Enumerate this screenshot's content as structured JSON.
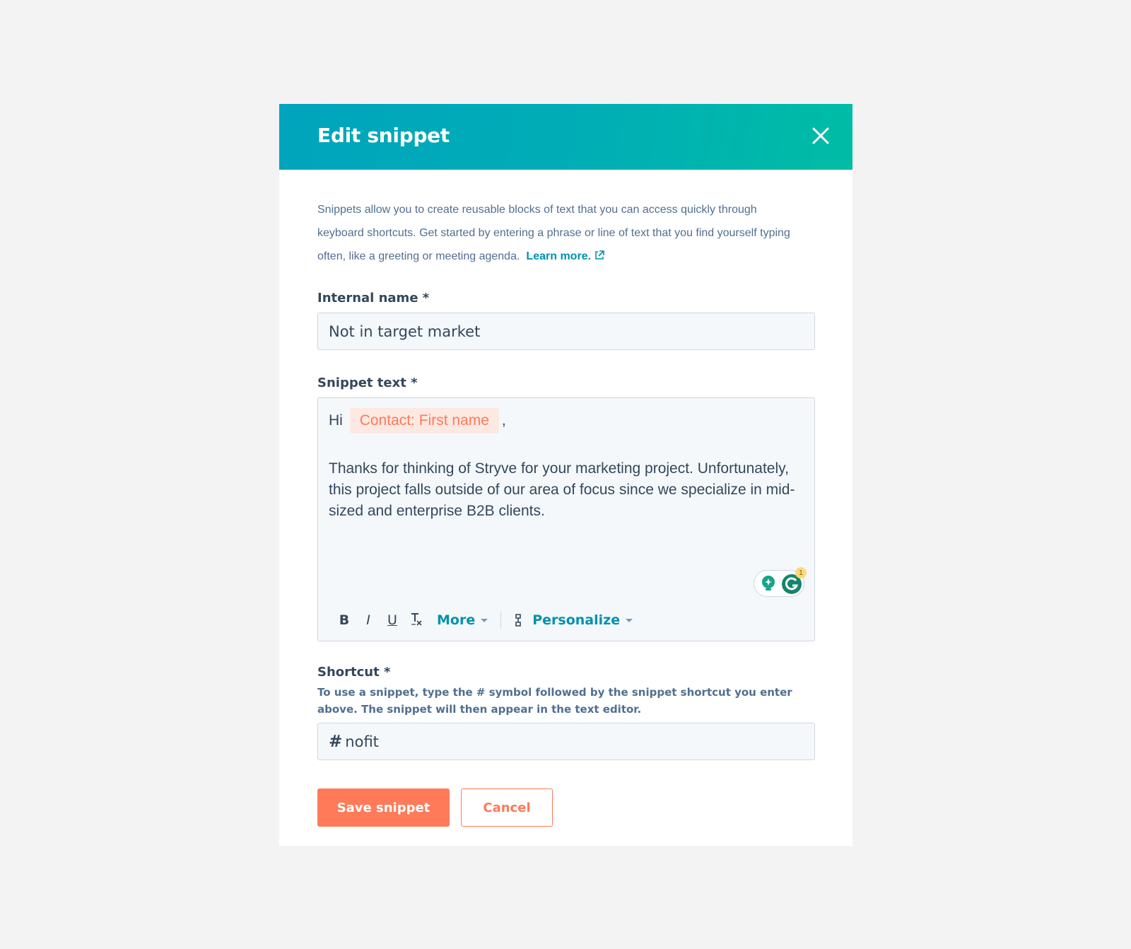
{
  "modal": {
    "title": "Edit snippet",
    "close_icon": "close-icon"
  },
  "intro": {
    "text": "Snippets allow you to create reusable blocks of text that you can access quickly through keyboard shortcuts. Get started by entering a phrase or line of text that you find yourself typing often, like a greeting or meeting agenda.",
    "link_label": "Learn more.",
    "link_icon": "external-link-icon"
  },
  "internal_name": {
    "label": "Internal name *",
    "value": "Not in target market"
  },
  "snippet_text": {
    "label": "Snippet text *",
    "greeting": "Hi",
    "token": "Contact: First name",
    "after_token": ",",
    "paragraph": "Thanks for thinking of Stryve for your marketing project. Unfortunately, this project falls outside of our area of focus since we specialize in mid-sized and enterprise B2B clients."
  },
  "toolbar": {
    "bold": "B",
    "italic": "I",
    "underline": "U",
    "clear_format": "Tx",
    "more_label": "More",
    "personalize_label": "Personalize"
  },
  "grammarly": {
    "badge_count": "1"
  },
  "shortcut": {
    "label": "Shortcut *",
    "help": "To use a snippet, type the # symbol followed by the snippet shortcut you enter above. The snippet will then appear in the text editor.",
    "prefix": "#",
    "value": "nofit"
  },
  "actions": {
    "save_label": "Save snippet",
    "cancel_label": "Cancel"
  },
  "colors": {
    "header_start": "#00a4bd",
    "header_end": "#00bda5",
    "primary": "#ff7a59",
    "link": "#0091ae",
    "text": "#33475b"
  }
}
